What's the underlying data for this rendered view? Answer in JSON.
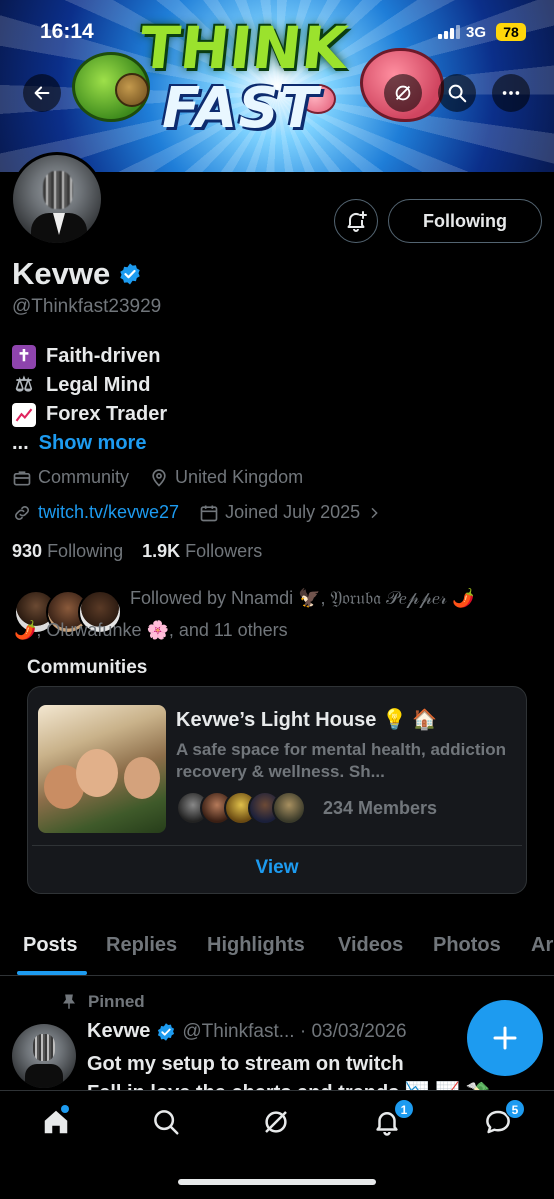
{
  "status_bar": {
    "time": "16:14",
    "network": "3G",
    "battery": "78"
  },
  "banner": {
    "title_line1": "THINK",
    "title_line2": "FAST"
  },
  "profile": {
    "follow_state_label": "Following",
    "name": "Kevwe",
    "handle": "@Thinkfast23929",
    "bio_lines": [
      {
        "icon": "latin-cross-icon",
        "text": "Faith-driven"
      },
      {
        "icon": "scales-icon",
        "text": "Legal Mind"
      },
      {
        "icon": "chart-increasing-icon",
        "text": "Forex Trader"
      }
    ],
    "bio_ellipsis": "...",
    "show_more": "Show more",
    "category": "Community",
    "location": "United Kingdom",
    "website": "twitch.tv/kevwe27",
    "joined": "Joined July 2025",
    "following_count": "930",
    "following_label": "Following",
    "followers_count": "1.9K",
    "followers_label": "Followers",
    "followed_by_line1": "Followed by Nnamdi 🦅, 𝔜𝔬𝔯𝔲𝔟𝔞 𝒫𝑒𝓅𝓅𝑒𝓇 🌶️",
    "followed_by_line2": "🌶️, Oluwafunke 🌸, and 11 others"
  },
  "communities": {
    "heading": "Communities",
    "card": {
      "name": "Kevwe’s Light House 💡 🏠",
      "description": "A safe space for mental health, addiction recovery & wellness. Sh...",
      "members": "234 Members",
      "view_label": "View"
    }
  },
  "tabs": [
    "Posts",
    "Replies",
    "Highlights",
    "Videos",
    "Photos",
    "Ar"
  ],
  "pinned_post": {
    "pinned_label": "Pinned",
    "author": "Kevwe",
    "handle_date": "@Thinkfast... · 03/03/2026",
    "text_line1": "Got my setup to stream on twitch",
    "text_line2": "Fell in love the charts and trends 📉 📈 💸"
  },
  "nav": {
    "notifications_badge": "1",
    "messages_badge": "5"
  },
  "colors": {
    "accent": "#1d9bf0",
    "background": "#000000",
    "muted_text": "#71767b",
    "primary_text": "#e7e9ea",
    "battery": "#ffd60a"
  }
}
